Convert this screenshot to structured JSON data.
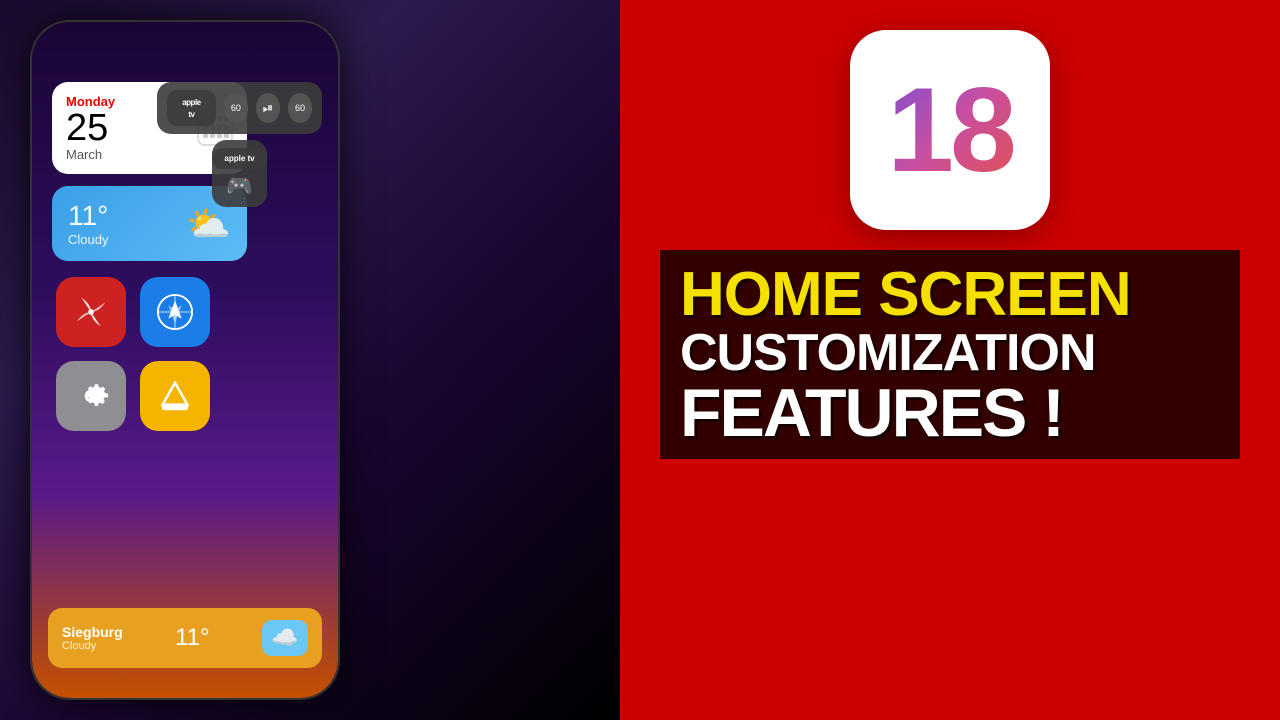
{
  "background": {
    "left_color": "#1a0535",
    "right_color": "#cc0000"
  },
  "phone": {
    "calendar_widget": {
      "day_name": "Monday",
      "day_number": "25",
      "month": "March"
    },
    "weather_widget": {
      "temperature": "11°",
      "condition": "Cloudy"
    },
    "apps": [
      {
        "name": "Pinwheel",
        "color": "#cc2222"
      },
      {
        "name": "Safari",
        "color": "#1a7de8"
      },
      {
        "name": "Settings",
        "color": "#8e8e93"
      },
      {
        "name": "Google Drive",
        "color": "#f4b400"
      }
    ],
    "control_center": {
      "appletv_label": "apple tv",
      "skip_back": "60",
      "play_pause": "⏯",
      "skip_forward": "60"
    },
    "bottom_bar": {
      "location": "Siegburg",
      "condition": "Cloudy",
      "temperature": "11°"
    }
  },
  "right_panel": {
    "ios_number": "18",
    "title_line1": "HOME SCREEN",
    "title_line2": "CUSTOMIZATION",
    "title_line3": "FEATURES !"
  }
}
